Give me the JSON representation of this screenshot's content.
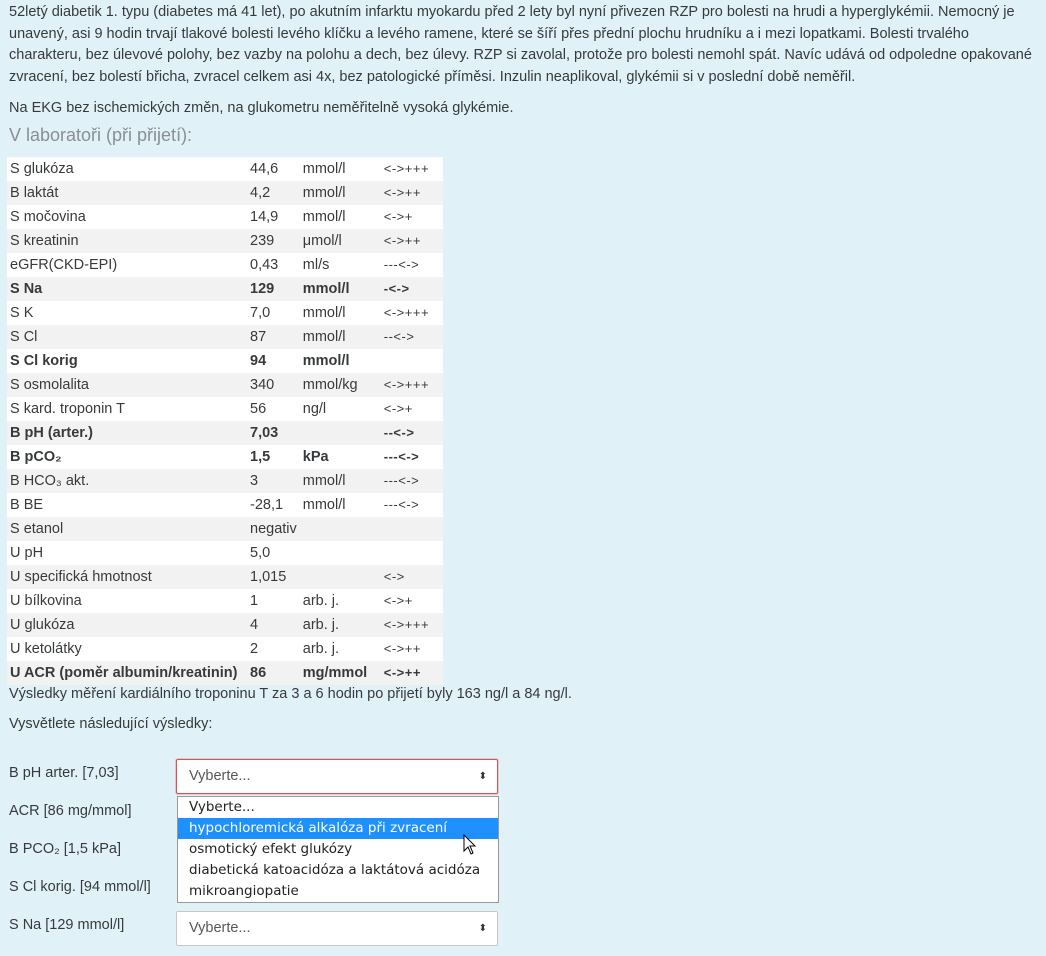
{
  "intro": {
    "p1": "52letý diabetik 1. typu (diabetes má 41 let), po akutním infarktu myokardu před 2 lety byl nyní přivezen RZP pro bolesti na hrudi a hyperglykémii. Nemocný je unavený, asi 9 hodin trvají tlakové bolesti levého klíčku a levého ramene, které se šíří přes přední plochu hrudníku a i mezi lopatkami. Bolesti trvalého charakteru, bez úlevové polohy, bez vazby na polohu a dech, bez úlevy. RZP si zavolal, protože pro bolesti nemohl spát. Navíc udává od odpoledne opakované zvracení, bez bolestí břicha, zvracel celkem asi 4x, bez patologické příměsi. Inzulin neaplikoval, glykémii si v poslední době neměřil.",
    "ekg": "Na EKG bez ischemických změn, na glukometru neměřitelně vysoká glykémie.",
    "lab_heading": "V laboratoři (při přijetí):"
  },
  "lab": [
    {
      "name": "S glukóza",
      "value": "44,6",
      "unit": "mmol/l",
      "flag": "<->+++",
      "bold": false
    },
    {
      "name": "B laktát",
      "value": "4,2",
      "unit": "mmol/l",
      "flag": "<->++",
      "bold": false
    },
    {
      "name": "S močovina",
      "value": "14,9",
      "unit": "mmol/l",
      "flag": "<->+",
      "bold": false
    },
    {
      "name": "S kreatinin",
      "value": "239",
      "unit": "μmol/l",
      "flag": "<->++",
      "bold": false
    },
    {
      "name": "eGFR(CKD-EPI)",
      "value": "0,43",
      "unit": "ml/s",
      "flag": "---<->",
      "bold": false
    },
    {
      "name": "S Na",
      "value": "129",
      "unit": "mmol/l",
      "flag": "-<->",
      "bold": true
    },
    {
      "name": "S K",
      "value": "7,0",
      "unit": "mmol/l",
      "flag": "<->+++",
      "bold": false
    },
    {
      "name": "S Cl",
      "value": "87",
      "unit": "mmol/l",
      "flag": "--<->",
      "bold": false
    },
    {
      "name": "S Cl korig",
      "value": "94",
      "unit": "mmol/l",
      "flag": "",
      "bold": true
    },
    {
      "name": "S osmolalita",
      "value": "340",
      "unit": "mmol/kg",
      "flag": "<->+++",
      "bold": false
    },
    {
      "name": "S kard. troponin T",
      "value": "56",
      "unit": "ng/l",
      "flag": "<->+",
      "bold": false
    },
    {
      "name": "B pH (arter.)",
      "value": "7,03",
      "unit": "",
      "flag": "--<->",
      "bold": true
    },
    {
      "name": "B pCO₂",
      "value": "1,5",
      "unit": "kPa",
      "flag": "---<->",
      "bold": true
    },
    {
      "name": "B HCO₃ akt.",
      "value": "3",
      "unit": "mmol/l",
      "flag": "---<->",
      "bold": false
    },
    {
      "name": "B BE",
      "value": "-28,1",
      "unit": "mmol/l",
      "flag": "---<->",
      "bold": false
    },
    {
      "name": "S etanol",
      "value": "negativ",
      "unit": "",
      "flag": "",
      "bold": false
    },
    {
      "name": "U pH",
      "value": "5,0",
      "unit": "",
      "flag": "",
      "bold": false
    },
    {
      "name": "U specifická hmotnost",
      "value": "1,015",
      "unit": "",
      "flag": "<->",
      "bold": false
    },
    {
      "name": "U bílkovina",
      "value": "1",
      "unit": "arb. j.",
      "flag": "<->+",
      "bold": false
    },
    {
      "name": "U glukóza",
      "value": "4",
      "unit": "arb. j.",
      "flag": "<->+++",
      "bold": false
    },
    {
      "name": "U ketolátky",
      "value": "2",
      "unit": "arb. j.",
      "flag": "<->++",
      "bold": false
    },
    {
      "name": "U ACR (poměr albumin/kreatinin)",
      "value": "86",
      "unit": "mg/mmol",
      "flag": "<->++",
      "bold": true
    }
  ],
  "after_text": "Výsledky měření kardiálního troponinu T za 3 a 6 hodin po přijetí byly 163 ng/l a 84 ng/l.",
  "explain_text": "Vysvětlete následující výsledky:",
  "questions": {
    "q1": {
      "label": "B pH arter. [7,03]",
      "selected": "Vyberte..."
    },
    "q2": {
      "label": "ACR [86 mg/mmol]"
    },
    "q3": {
      "label": "B PCO₂ [1,5 kPa]"
    },
    "q4": {
      "label": "S Cl korig. [94 mmol/l]"
    },
    "q5": {
      "label": "S Na [129 mmol/l]",
      "selected": "Vyberte..."
    }
  },
  "dropdown": {
    "options": [
      "Vyberte...",
      "hypochloremická alkalóza při zvracení",
      "osmotický efekt glukózy",
      "diabetická katoacidóza a laktátová acidóza",
      "mikroangiopatie"
    ],
    "highlighted_index": 1,
    "highlight_color": "#1e90ff"
  },
  "colors": {
    "background": "#e0f2f8",
    "invalid_border": "#d9534f",
    "muted_heading": "#8a8f93"
  }
}
